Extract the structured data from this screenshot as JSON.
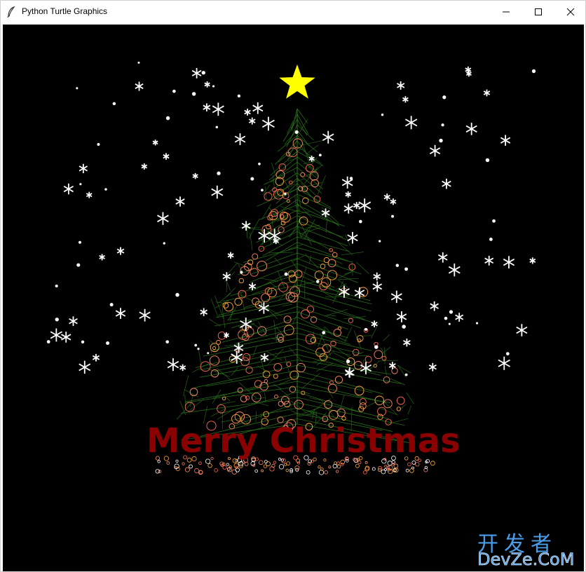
{
  "window": {
    "title": "Python Turtle Graphics",
    "icon": "feather-icon",
    "controls": [
      "minimize-icon",
      "maximize-icon",
      "close-icon"
    ]
  },
  "canvas": {
    "background": "#000000",
    "greeting": "Merry Christmas",
    "greeting_color": "#8b0000",
    "star_color": "#ffff00",
    "snow_color": "#ffffff",
    "tree_color": "#2e7d1e",
    "ornament_colors": [
      "#ff6a5a",
      "#ffa640",
      "#ff8c69"
    ]
  },
  "watermark": {
    "chinese": "开发者",
    "latin": "DevZe.CoM",
    "color": "#4a9be8"
  }
}
